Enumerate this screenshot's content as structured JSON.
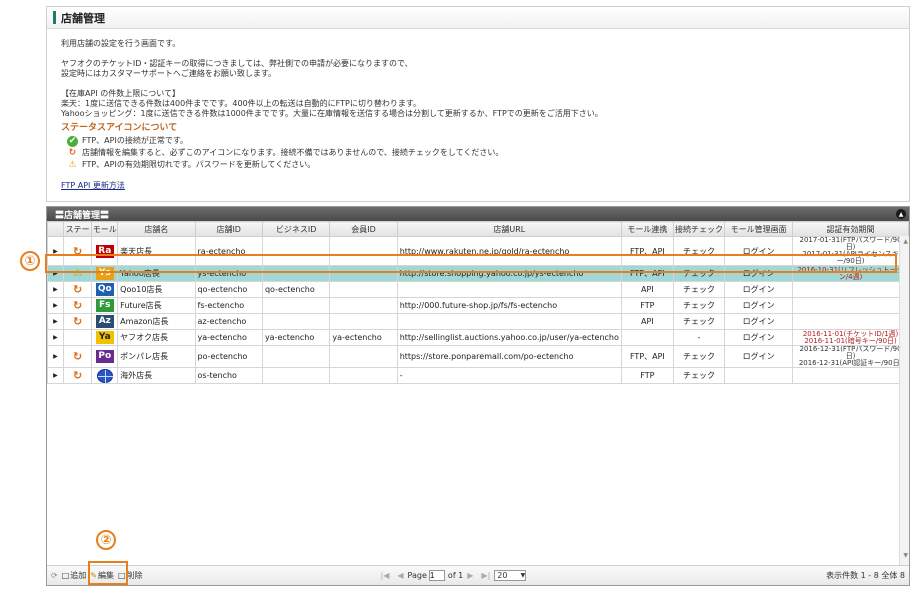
{
  "panel": {
    "title": "店舗管理",
    "description1": "利用店舗の設定を行う画面です。",
    "description2a": "ヤフオクのチケットID・認証キーの取得につきましては、弊社側での申請が必要になりますので、",
    "description2b": "設定時にはカスタマーサポートへご連絡をお願い致します。",
    "api_limit_title": "【在庫API の件数上限について】",
    "api_limit_rakuten": "楽天：1度に送信できる件数は400件までです。400件以上の転送は自動的にFTPに切り替わります。",
    "api_limit_yahoo": "Yahooショッピング：1度に送信できる件数は1000件までです。大量に在庫情報を送信する場合は分割して更新するか、FTPでの更新をご活用下さい。",
    "status_heading": "ステータスアイコンについて",
    "status_items": [
      {
        "icon": "check-icon",
        "text": "FTP、APIの接続が正常です。"
      },
      {
        "icon": "refresh-icon",
        "text": "店舗情報を編集すると、必ずこのアイコンになります。接続不備ではありませんので、接続チェックをしてください。"
      },
      {
        "icon": "warning-icon",
        "text": "FTP、APIの有効期限切れです。パスワードを更新してください。"
      }
    ],
    "ftp_link": "FTP API 更新方法"
  },
  "grid": {
    "title": "〓店舗管理〓",
    "columns": [
      "",
      "ステー",
      "モール",
      "店舗名",
      "店舗ID",
      "ビジネスID",
      "会員ID",
      "店舗URL",
      "モール連携",
      "接続チェック",
      "モール管理画面",
      "認証有効期間"
    ],
    "rows": [
      {
        "status": "refresh",
        "mall": "Ra",
        "mall_color": "#bf0000",
        "name": "楽天店長",
        "store_id": "ra-ectencho",
        "biz_id": "",
        "member_id": "",
        "url": "http://www.rakuten.ne.jp/gold/ra-ectencho",
        "link": "FTP、API",
        "check": "チェック",
        "admin": "ログイン",
        "expire1": "2017-01-31(FTPパスワード/90日)",
        "expire2": "2017-01-31(APIライセンスキー/90日)",
        "red": false,
        "selected": false
      },
      {
        "status": "warning",
        "mall": "Ys",
        "mall_color": "#e8a21a",
        "name": "Yahoo店長",
        "store_id": "ys-ectencho",
        "biz_id": "",
        "member_id": "",
        "url": "http://store.shopping.yahoo.co.jp/ys-ectencho",
        "link": "FTP、API",
        "check": "チェック",
        "admin": "ログイン",
        "expire1": "2016-10-31(リフレッシュトークン/4週)",
        "expire2": "",
        "red": true,
        "selected": true
      },
      {
        "status": "refresh",
        "mall": "Qo",
        "mall_color": "#1f5fb0",
        "name": "Qoo10店長",
        "store_id": "qo-ectencho",
        "biz_id": "qo-ectencho",
        "member_id": "",
        "url": "",
        "link": "API",
        "check": "チェック",
        "admin": "ログイン",
        "expire1": "",
        "expire2": "",
        "red": false,
        "selected": false
      },
      {
        "status": "refresh",
        "mall": "Fs",
        "mall_color": "#2e9a3a",
        "name": "Future店長",
        "store_id": "fs-ectencho",
        "biz_id": "",
        "member_id": "",
        "url": "http://000.future-shop.jp/fs/fs-ectencho",
        "link": "FTP",
        "check": "チェック",
        "admin": "ログイン",
        "expire1": "",
        "expire2": "",
        "red": false,
        "selected": false
      },
      {
        "status": "refresh",
        "mall": "Az",
        "mall_color": "#2a4d73",
        "name": "Amazon店長",
        "store_id": "az-ectencho",
        "biz_id": "",
        "member_id": "",
        "url": "",
        "link": "API",
        "check": "チェック",
        "admin": "ログイン",
        "expire1": "",
        "expire2": "",
        "red": false,
        "selected": false
      },
      {
        "status": "",
        "mall": "Ya",
        "mall_color": "#f2c200",
        "name": "ヤフオク店長",
        "store_id": "ya-ectencho",
        "biz_id": "ya-ectencho",
        "member_id": "ya-ectencho",
        "url": "http://sellinglist.auctions.yahoo.co.jp/user/ya-ectencho",
        "link": "",
        "check": "-",
        "admin": "ログイン",
        "expire1": "2016-11-01(チケットID/1週)",
        "expire2": "2016-11-01(暗号キー/90日)",
        "red": true,
        "selected": false
      },
      {
        "status": "refresh",
        "mall": "Po",
        "mall_color": "#6a2b8f",
        "name": "ポンパレ店長",
        "store_id": "po-ectencho",
        "biz_id": "",
        "member_id": "",
        "url": "https://store.ponparemall.com/po-ectencho",
        "link": "FTP、API",
        "check": "チェック",
        "admin": "ログイン",
        "expire1": "2016-12-31(FTPパスワード/90日)",
        "expire2": "2016-12-31(API認証キー/90日)",
        "red": false,
        "selected": false
      },
      {
        "status": "refresh",
        "mall": "globe",
        "mall_color": "#2a56c6",
        "name": "海外店長",
        "store_id": "os-tencho",
        "biz_id": "",
        "member_id": "",
        "url": "-",
        "link": "FTP",
        "check": "チェック",
        "admin": "",
        "expire1": "",
        "expire2": "",
        "red": false,
        "selected": false
      }
    ]
  },
  "pager": {
    "add": "追加",
    "edit": "編集",
    "delete": "削除",
    "page_label": "Page",
    "page_value": "1",
    "of_label": "of 1",
    "per_page": "20",
    "display_count": "表示件数 1 - 8 全体 8"
  },
  "annotations": {
    "one": "①",
    "two": "②"
  },
  "colors": {
    "accent": "#e87f1c",
    "selected_row": "#9fd8d4",
    "title_bar": "#1c7a6e"
  }
}
